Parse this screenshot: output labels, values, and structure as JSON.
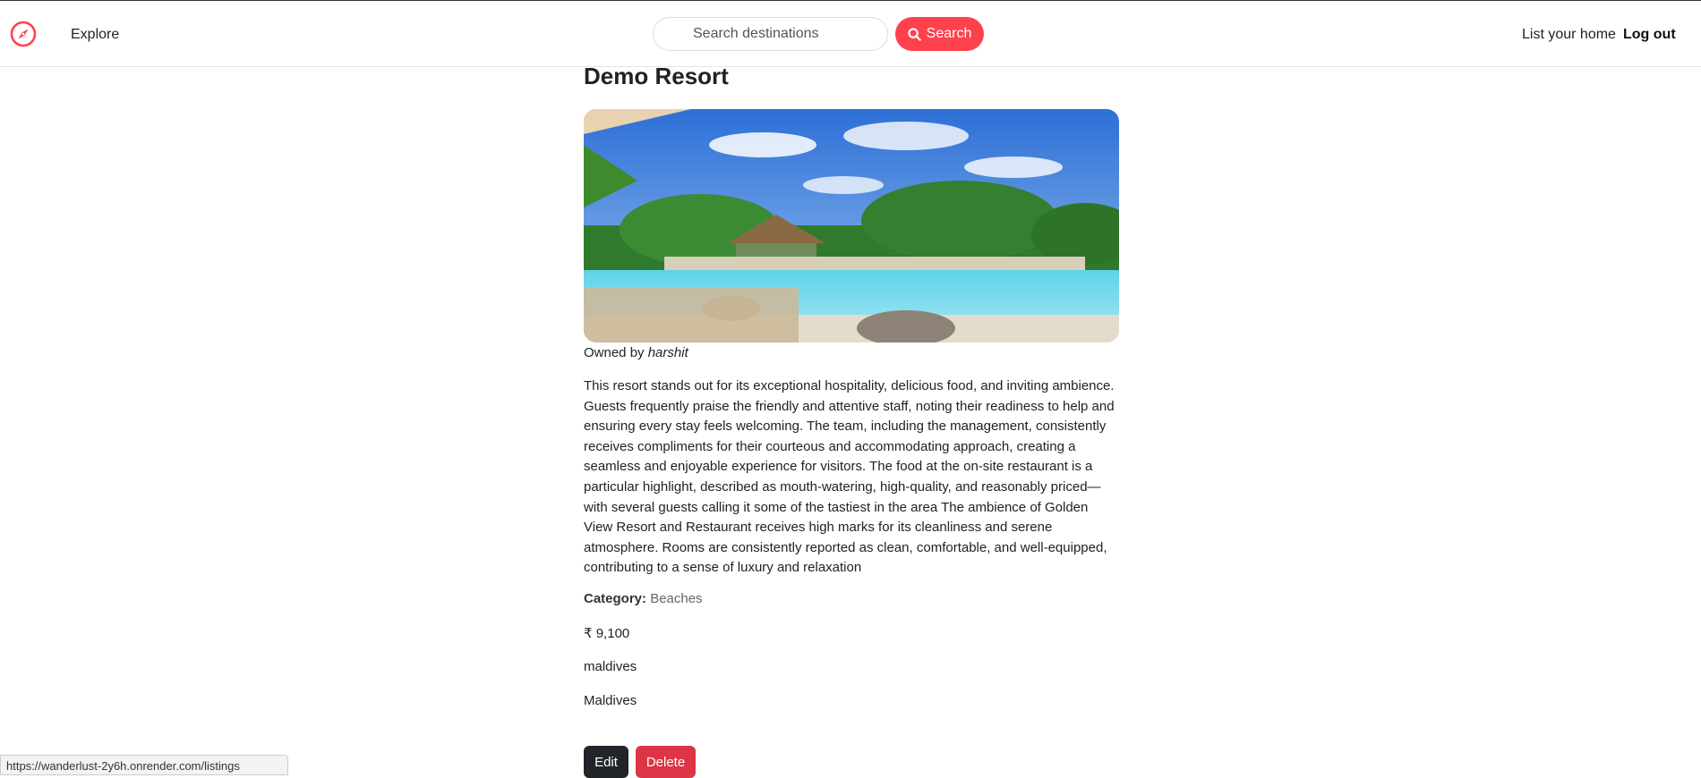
{
  "nav": {
    "explore": "Explore",
    "search_placeholder": "Search destinations",
    "search_button": "Search",
    "list_home": "List your home",
    "logout": "Log out"
  },
  "listing": {
    "title": "Demo Resort",
    "owned_prefix": "Owned by",
    "owner": "harshit",
    "description": "This resort stands out for its exceptional hospitality, delicious food, and inviting ambience. Guests frequently praise the friendly and attentive staff, noting their readiness to help and ensuring every stay feels welcoming. The team, including the management, consistently receives compliments for their courteous and accommodating approach, creating a seamless and enjoyable experience for visitors. The food at the on-site restaurant is a particular highlight, described as mouth-watering, high-quality, and reasonably priced—with several guests calling it some of the tastiest in the area The ambience of Golden View Resort and Restaurant receives high marks for its cleanliness and serene atmosphere. Rooms are consistently reported as clean, comfortable, and well-equipped, contributing to a sense of luxury and relaxation",
    "category_label": "Category:",
    "category": "Beaches",
    "price": "₹ 9,100",
    "location": "maldives",
    "country": "Maldives",
    "edit": "Edit",
    "delete": "Delete"
  },
  "status_url": "https://wanderlust-2y6h.onrender.com/listings",
  "colors": {
    "brand": "#fe424d",
    "delete": "#dc3545",
    "edit": "#212529"
  },
  "icons": [
    "compass-icon",
    "search-icon"
  ]
}
